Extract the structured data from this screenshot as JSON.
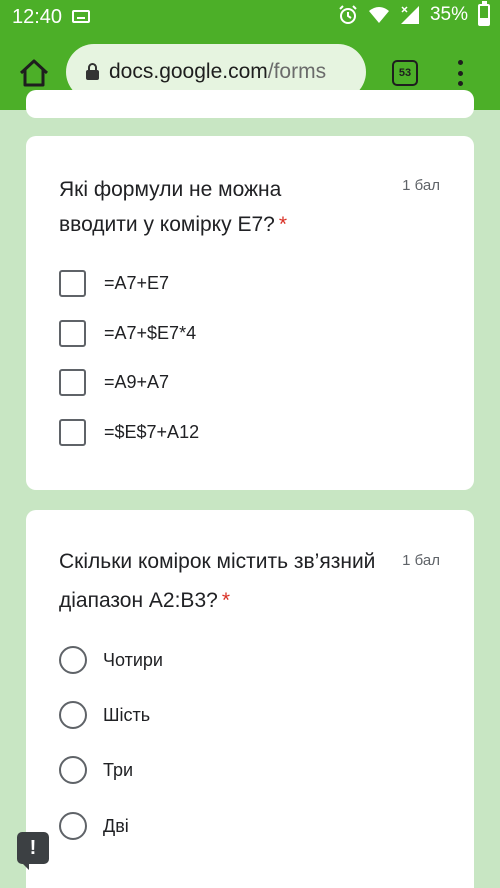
{
  "status_bar": {
    "time": "12:40",
    "battery_percent": "35%",
    "icons": [
      "keyboard-icon",
      "alarm-icon",
      "wifi-icon",
      "signal-icon",
      "battery-icon"
    ]
  },
  "browser": {
    "url_host": "docs.google.com",
    "url_path": "/forms",
    "tab_count": "53"
  },
  "questions": [
    {
      "title": "Які формули не можна вводити у комірку E7?",
      "required_mark": "*",
      "points": "1 бал",
      "type": "checkbox",
      "options": [
        "=A7+E7",
        "=A7+$E7*4",
        "=A9+A7",
        "=$E$7+A12"
      ]
    },
    {
      "title": "Скільки комірок містить зв’язний діапазон А2:В3?",
      "required_mark": "*",
      "points": "1 бал",
      "type": "radio",
      "options": [
        "Чотири",
        "Шість",
        "Три",
        "Дві"
      ]
    }
  ],
  "feedback_button": {
    "label": "!"
  },
  "colors": {
    "toolbar": "#4caf28",
    "background": "#c8e6c3",
    "required": "#d93025"
  }
}
